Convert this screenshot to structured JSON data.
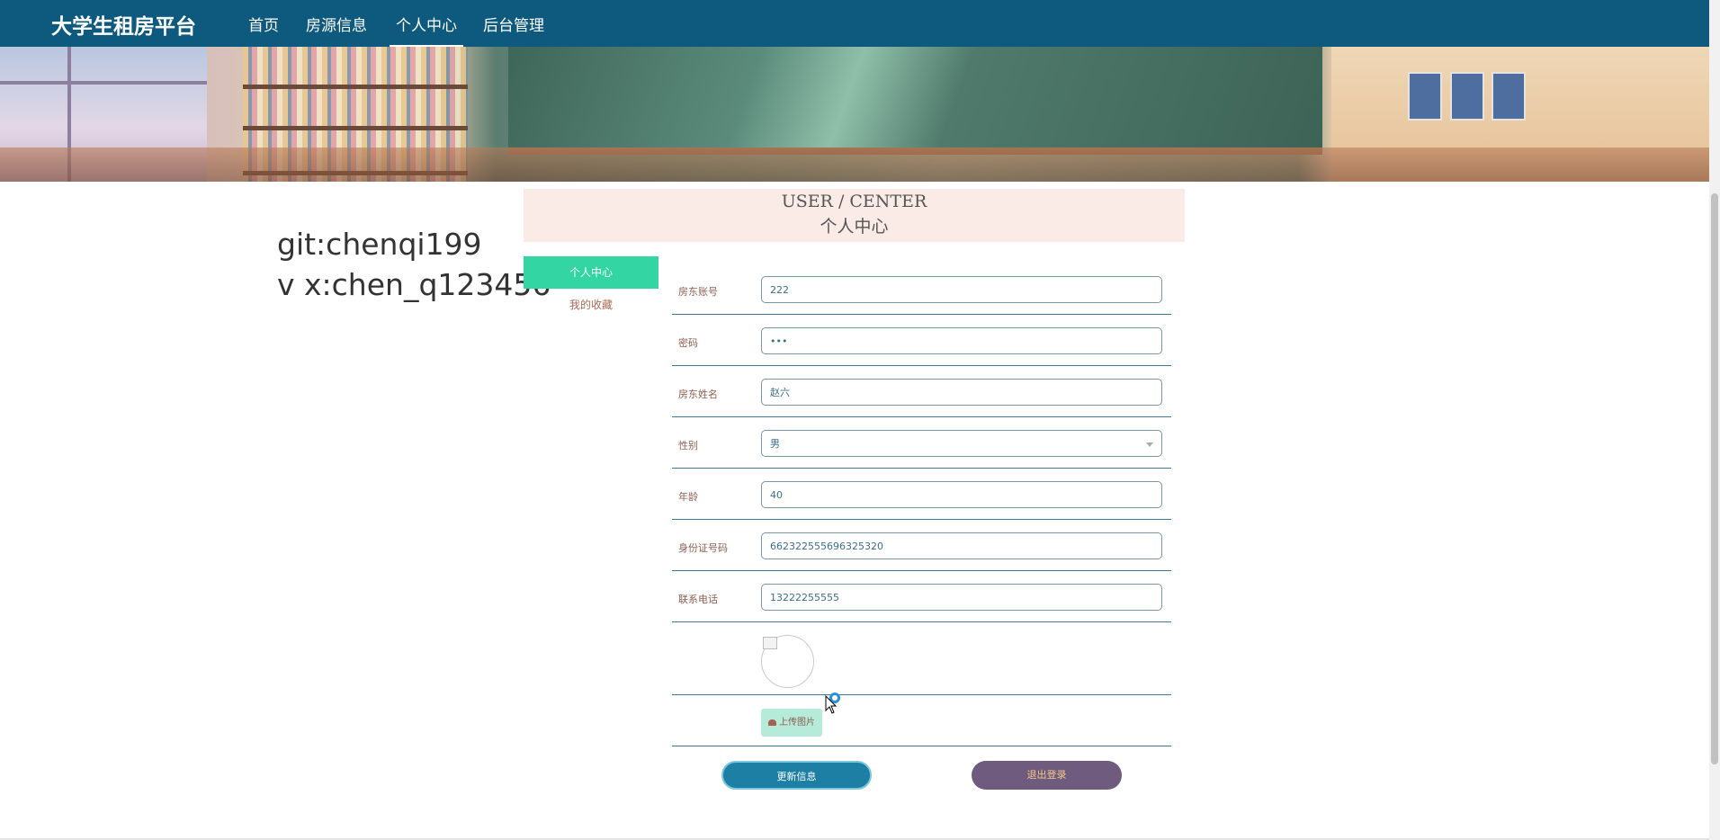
{
  "nav": {
    "brand": "大学生租房平台",
    "links": [
      "首页",
      "房源信息",
      "个人中心",
      "后台管理"
    ],
    "active": "个人中心"
  },
  "watermark": {
    "line1": "git:chenqi199",
    "line2": "v x:chen_q123456"
  },
  "header": {
    "title_en": "USER / CENTER",
    "title_cn": "个人中心"
  },
  "side_menu": {
    "items": [
      "个人中心",
      "我的收藏"
    ],
    "active": "个人中心"
  },
  "form": {
    "fields": [
      {
        "label": "房东账号",
        "value": "222"
      },
      {
        "label": "密码",
        "value": "•••"
      },
      {
        "label": "房东姓名",
        "value": "赵六"
      },
      {
        "label": "性别",
        "value": "男"
      },
      {
        "label": "年龄",
        "value": "40"
      },
      {
        "label": "身份证号码",
        "value": "662322555696325320"
      },
      {
        "label": "联系电话",
        "value": "13222255555"
      }
    ],
    "upload_label": "上传图片",
    "update_button": "更新信息",
    "logout_button": "退出登录"
  },
  "colors": {
    "nav_bg": "#0e5a7e",
    "active_menu": "#33d6a3",
    "update_btn": "#1d7fa3",
    "logout_btn": "#6f5b7d"
  }
}
